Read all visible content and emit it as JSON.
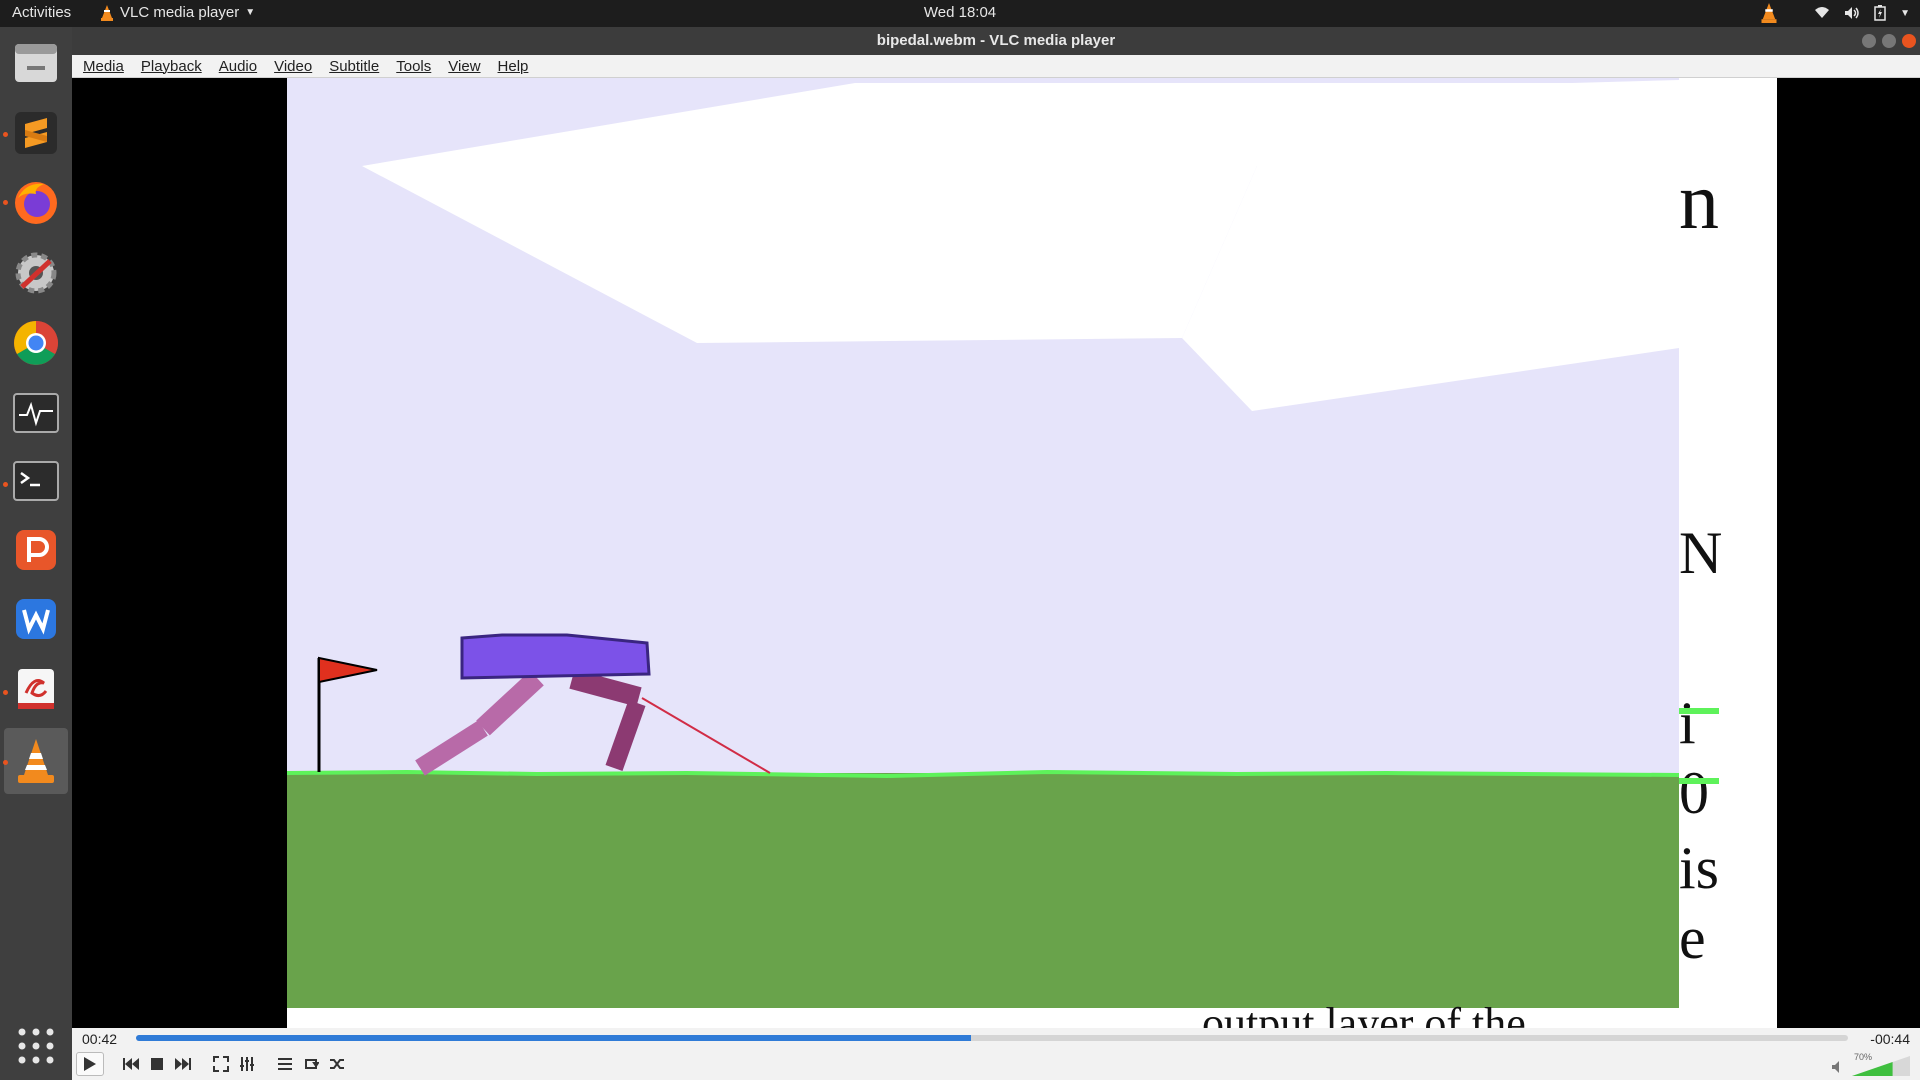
{
  "topbar": {
    "activities": "Activities",
    "app_name": "VLC media player",
    "clock": "Wed 18:04"
  },
  "window": {
    "title": "bipedal.webm - VLC media player"
  },
  "menu": [
    "Media",
    "Playback",
    "Audio",
    "Video",
    "Subtitle",
    "Tools",
    "View",
    "Help"
  ],
  "dock": [
    {
      "name": "files-icon",
      "running": false
    },
    {
      "name": "sublime-text-icon",
      "running": true
    },
    {
      "name": "firefox-icon",
      "running": true
    },
    {
      "name": "system-settings-icon",
      "running": false
    },
    {
      "name": "chrome-icon",
      "running": false
    },
    {
      "name": "system-monitor-icon",
      "running": false
    },
    {
      "name": "terminal-icon",
      "running": true
    },
    {
      "name": "wps-presentation-icon",
      "running": false
    },
    {
      "name": "wps-writer-icon",
      "running": false
    },
    {
      "name": "evince-icon",
      "running": true
    },
    {
      "name": "vlc-icon",
      "running": true
    }
  ],
  "video": {
    "side_text_glyphs": [
      "n",
      "N",
      "i",
      "0",
      "is",
      "e"
    ],
    "bottom_text": "output layer of the"
  },
  "player": {
    "elapsed": "00:42",
    "remaining": "-00:44",
    "progress": 0.488,
    "volume_label": "70%",
    "volume": 0.7
  },
  "colors": {
    "accent": "#2f7bd7",
    "sky": "#e6e4fa",
    "ground": "#69a34b",
    "ground_edge": "#5ef25a",
    "hull": "#7c52e8",
    "leg_back": "#b86aa8",
    "leg_front": "#8c3a72",
    "flag": "#e0301e"
  }
}
